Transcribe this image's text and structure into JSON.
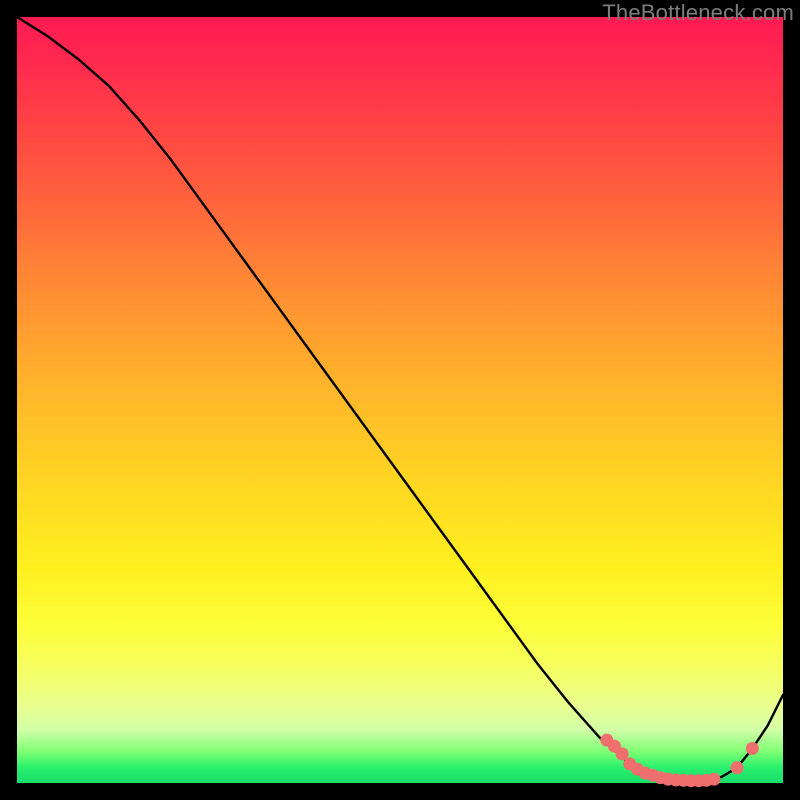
{
  "attribution": "TheBottleneck.com",
  "colors": {
    "page_bg": "#000000",
    "line": "#000000",
    "marker_fill": "#ef6e6e",
    "marker_stroke": "#ef6e6e",
    "gradient_top": "#ff1a52",
    "gradient_mid": "#ffd423",
    "gradient_bottom": "#18de6a"
  },
  "chart_data": {
    "type": "line",
    "title": "",
    "xlabel": "",
    "ylabel": "",
    "xlim": [
      0,
      100
    ],
    "ylim": [
      0,
      100
    ],
    "grid": false,
    "legend": false,
    "series": [
      {
        "name": "bottleneck-curve",
        "x": [
          0,
          4,
          8,
          12,
          16,
          20,
          24,
          28,
          32,
          36,
          40,
          44,
          48,
          52,
          56,
          60,
          64,
          68,
          72,
          76,
          80,
          82,
          84,
          86,
          88,
          90,
          92,
          94,
          96,
          98,
          100
        ],
        "y": [
          100,
          97.5,
          94.5,
          91,
          86.5,
          81.5,
          76,
          70.5,
          65,
          59.5,
          54,
          48.5,
          43,
          37.5,
          32,
          26.5,
          21,
          15.5,
          10.5,
          6.0,
          2.5,
          1.3,
          0.7,
          0.4,
          0.3,
          0.35,
          0.8,
          2.0,
          4.5,
          7.5,
          11.5
        ]
      }
    ],
    "markers": {
      "name": "optimal-range",
      "x": [
        77,
        78,
        79,
        80,
        81,
        82,
        83,
        84,
        85,
        86,
        87,
        88,
        89,
        90,
        91,
        94,
        96
      ],
      "y": [
        5.6,
        4.8,
        3.8,
        2.5,
        1.8,
        1.3,
        1.0,
        0.7,
        0.5,
        0.4,
        0.35,
        0.3,
        0.3,
        0.35,
        0.5,
        2.0,
        4.5
      ]
    }
  }
}
